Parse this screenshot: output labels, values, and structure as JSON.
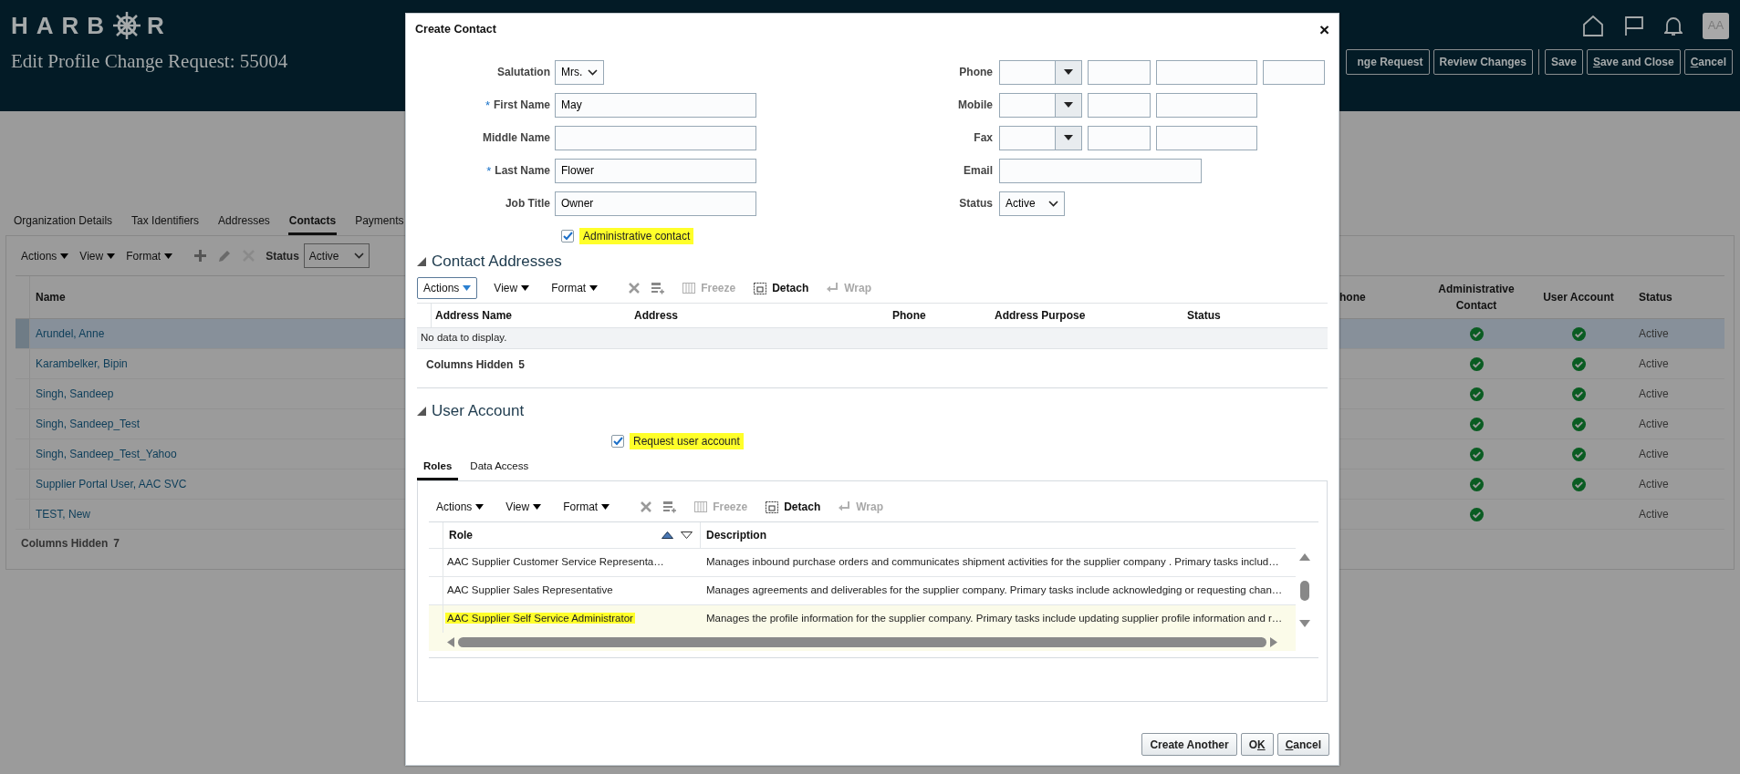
{
  "header": {
    "logo": {
      "before": "HARB",
      "after": "R"
    },
    "title": "Edit Profile Change Request: 55004",
    "avatar": "AA",
    "action_groups": [
      [
        {
          "label": "nge Request"
        },
        {
          "label": "Review Changes"
        }
      ],
      [
        {
          "label": "Save"
        },
        {
          "key": "S",
          "after": "ave and Close"
        },
        {
          "key": "C",
          "after": "ancel"
        }
      ]
    ]
  },
  "tabs": [
    {
      "label": "Organization Details",
      "selected": false
    },
    {
      "label": "Tax Identifiers",
      "selected": false
    },
    {
      "label": "Addresses",
      "selected": false
    },
    {
      "label": "Contacts",
      "selected": true
    },
    {
      "label": "Payments",
      "selected": false
    }
  ],
  "toolbar": {
    "menus": [
      "Actions",
      "View",
      "Format"
    ],
    "status_label": "Status",
    "status_value": "Active"
  },
  "contacts": {
    "columns": {
      "name": "Name",
      "column_2": "hone",
      "admin": "Administrative Contact",
      "user": "User Account",
      "status": "Status"
    },
    "rows": [
      {
        "name": "Arundel, Anne",
        "admin_contact": true,
        "user_account": true,
        "status": "Active",
        "selected": true
      },
      {
        "name": "Karambelker, Bipin",
        "admin_contact": true,
        "user_account": true,
        "status": "Active",
        "selected": false
      },
      {
        "name": "Singh, Sandeep",
        "admin_contact": true,
        "user_account": true,
        "status": "Active",
        "selected": false
      },
      {
        "name": "Singh, Sandeep_Test",
        "admin_contact": true,
        "user_account": true,
        "status": "Active",
        "selected": false
      },
      {
        "name": "Singh, Sandeep_Test_Yahoo",
        "admin_contact": true,
        "user_account": true,
        "status": "Active",
        "selected": false
      },
      {
        "name": "Supplier Portal User, AAC SVC",
        "admin_contact": true,
        "user_account": true,
        "status": "Active",
        "selected": false
      },
      {
        "name": "TEST, New",
        "admin_contact": true,
        "user_account": false,
        "status": "Active",
        "selected": false
      }
    ],
    "hidden_label": "Columns Hidden",
    "hidden_count": "7"
  },
  "dialog": {
    "title": "Create Contact",
    "close": "×",
    "left_fields": [
      {
        "label": "Salutation",
        "kind": "select",
        "value": "Mrs."
      },
      {
        "label": "First Name",
        "kind": "text",
        "value": "May",
        "required_mark": "*"
      },
      {
        "label": "Middle Name",
        "kind": "text"
      },
      {
        "label": "Last Name",
        "kind": "text",
        "value": "Flower",
        "required_mark": "*"
      },
      {
        "label": "Job Title",
        "kind": "text",
        "value": "Owner"
      }
    ],
    "right_fields": [
      {
        "label": "Phone",
        "kind": "phone_ext"
      },
      {
        "label": "Mobile",
        "kind": "phone"
      },
      {
        "label": "Fax",
        "kind": "phone"
      },
      {
        "label": "Email",
        "kind": "text"
      },
      {
        "label": "Status",
        "kind": "select",
        "value": "Active"
      }
    ],
    "admin_checkbox": {
      "label": "Administrative contact",
      "checked": true,
      "highlighted": true
    },
    "addresses": {
      "heading": "Contact Addresses",
      "expanded": true,
      "menus": [
        {
          "label": "Actions",
          "focused": true
        },
        {
          "label": "View",
          "focused": false
        },
        {
          "label": "Format",
          "focused": false
        }
      ],
      "tools": [
        {
          "label": "Freeze",
          "disabled": true
        },
        {
          "label": "Detach",
          "disabled": false
        },
        {
          "label": "Wrap",
          "disabled": true
        }
      ],
      "columns": [
        "Address Name",
        "Address",
        "Phone",
        "Address Purpose",
        "Status"
      ],
      "empty_text": "No data to display.",
      "hidden_label": "Columns Hidden",
      "hidden_count": "5"
    },
    "user_account": {
      "heading": "User Account",
      "expanded": true,
      "checkbox": {
        "label": "Request user account",
        "checked": true,
        "highlighted": true
      },
      "tabs": [
        {
          "label": "Roles",
          "selected": true
        },
        {
          "label": "Data Access",
          "selected": false
        }
      ],
      "menus": [
        {
          "label": "Actions",
          "focused": false
        },
        {
          "label": "View",
          "focused": false
        },
        {
          "label": "Format",
          "focused": false
        }
      ],
      "tools": [
        {
          "label": "Freeze",
          "disabled": true
        },
        {
          "label": "Detach",
          "disabled": false
        },
        {
          "label": "Wrap",
          "disabled": true
        }
      ],
      "columns": [
        "Role",
        "Description"
      ],
      "rows": [
        {
          "role": "AAC Supplier Customer Service Representa…",
          "description": "Manages inbound purchase orders and communicates shipment activities for the supplier company . Primary tasks includ…",
          "selected": false,
          "highlighted": false
        },
        {
          "role": "AAC Supplier Sales Representative",
          "description": "Manages agreements and deliverables for the supplier company. Primary tasks include acknowledging or requesting chan…",
          "selected": false,
          "highlighted": false
        },
        {
          "role": "AAC Supplier Self Service Administrator",
          "description": "Manages the profile information for the supplier company. Primary tasks include updating supplier profile information and r…",
          "selected": true,
          "highlighted": true
        }
      ]
    },
    "buttons": [
      {
        "label": "Create Another"
      },
      {
        "before": "O",
        "key": "K"
      },
      {
        "key": "C",
        "after": "ancel"
      }
    ]
  }
}
